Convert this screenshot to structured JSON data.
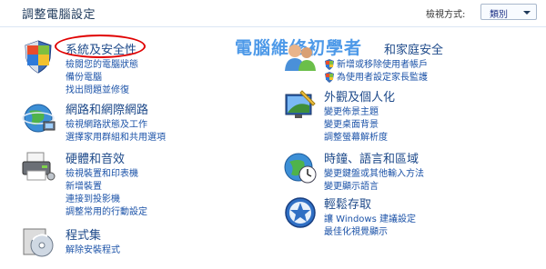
{
  "header": {
    "title": "調整電腦設定",
    "view_label": "檢視方式:",
    "view_value": "類別"
  },
  "watermark": "電腦維修初學者",
  "categories_left": [
    {
      "title": "系統及安全性",
      "icon": "shield-icon",
      "links": [
        "檢閱您的電腦狀態",
        "備份電腦",
        "找出問題並修復"
      ]
    },
    {
      "title": "網路和網際網路",
      "icon": "network-globe-icon",
      "links": [
        "檢視網路狀態及工作",
        "選擇家用群組和共用選項"
      ]
    },
    {
      "title": "硬體和音效",
      "icon": "printer-icon",
      "links": [
        "檢視裝置和印表機",
        "新增裝置",
        "連接到投影機",
        "調整常用的行動設定"
      ]
    },
    {
      "title": "程式集",
      "icon": "programs-disc-icon",
      "links": [
        "解除安裝程式"
      ]
    }
  ],
  "categories_right": [
    {
      "title": "和家庭安全",
      "icon": "users-icon",
      "links": [
        "新增或移除使用者帳戶",
        "為使用者設定家長監護"
      ]
    },
    {
      "title": "外觀及個人化",
      "icon": "appearance-monitor-icon",
      "links": [
        "變更佈景主題",
        "變更桌面背景",
        "調整螢幕解析度"
      ]
    },
    {
      "title": "時鐘、語言和區域",
      "icon": "clock-globe-icon",
      "links": [
        "變更鍵盤或其他輸入方法",
        "變更顯示語言"
      ]
    },
    {
      "title": "輕鬆存取",
      "icon": "ease-of-access-icon",
      "links": [
        "讓 Windows 建議設定",
        "最佳化視覺顯示"
      ]
    }
  ],
  "colors": {
    "link": "#1c53a8",
    "title": "#1e4a8a",
    "watermark": "#3a8ee6",
    "annotation": "#e00000"
  }
}
